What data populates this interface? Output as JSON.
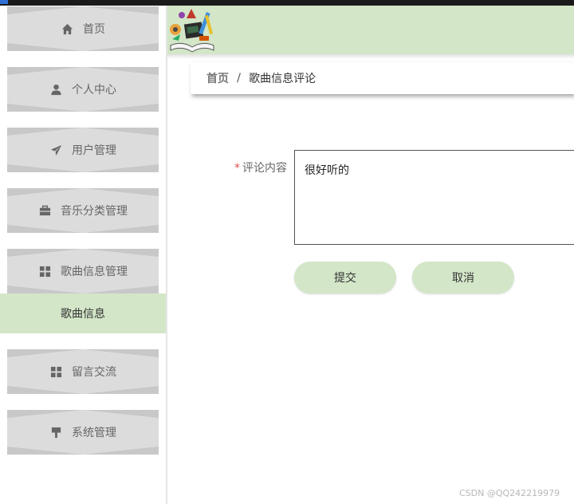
{
  "sidebar": {
    "items": [
      {
        "label": "首页",
        "icon": "home-icon"
      },
      {
        "label": "个人中心",
        "icon": "user-icon"
      },
      {
        "label": "用户管理",
        "icon": "paper-plane-icon"
      },
      {
        "label": "音乐分类管理",
        "icon": "briefcase-icon"
      },
      {
        "label": "歌曲信息管理",
        "icon": "grid-icon"
      },
      {
        "label": "留言交流",
        "icon": "grid-icon"
      },
      {
        "label": "系统管理",
        "icon": "brush-icon"
      }
    ],
    "active_submenu": "歌曲信息"
  },
  "breadcrumb": {
    "home": "首页",
    "separator": "/",
    "current": "歌曲信息评论"
  },
  "form": {
    "required_mark": "*",
    "comment_label": "评论内容",
    "comment_value": "很好听的",
    "submit_label": "提交",
    "cancel_label": "取消"
  },
  "watermark": "CSDN @QQ242219979",
  "colors": {
    "accent_green": "#d3e6c8",
    "menu_gray": "#dcdcdc"
  }
}
